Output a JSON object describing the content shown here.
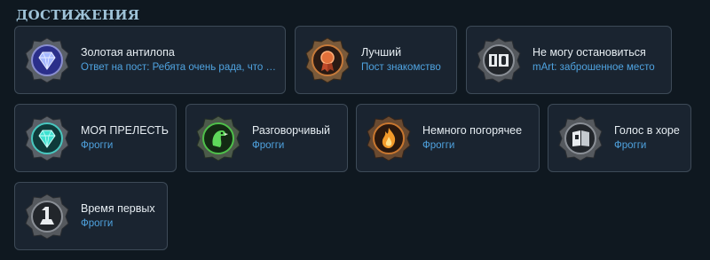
{
  "section": {
    "title": "ДОСТИЖЕНИЯ"
  },
  "achievements": [
    {
      "name": "Золотая антилопа",
      "link": "Ответ на пост: Ребята очень рада, что вы со мной!",
      "icon": "diamond-icon"
    },
    {
      "name": "Лучший",
      "link": "Пост знакомство",
      "icon": "medal-icon"
    },
    {
      "name": "Не могу остановиться",
      "link": "mArt: заброшенное место",
      "icon": "counter-icon"
    },
    {
      "name": "МОЯ ПРЕЛЕСТЬ",
      "link": "Фрогги",
      "icon": "gem-icon"
    },
    {
      "name": "Разговорчивый",
      "link": "Фрогги",
      "icon": "parrot-icon"
    },
    {
      "name": "Немного погорячее",
      "link": "Фрогги",
      "icon": "flame-icon"
    },
    {
      "name": "Голос в хоре",
      "link": "Фрогги",
      "icon": "flag-icon"
    },
    {
      "name": "Время первых",
      "link": "Фрогги",
      "icon": "first-place-icon"
    }
  ],
  "colors": {
    "background": "#0f1820",
    "card": "#1a2430",
    "border": "#3d4a57",
    "link": "#4fa3e0",
    "title": "#9fc3d8"
  }
}
